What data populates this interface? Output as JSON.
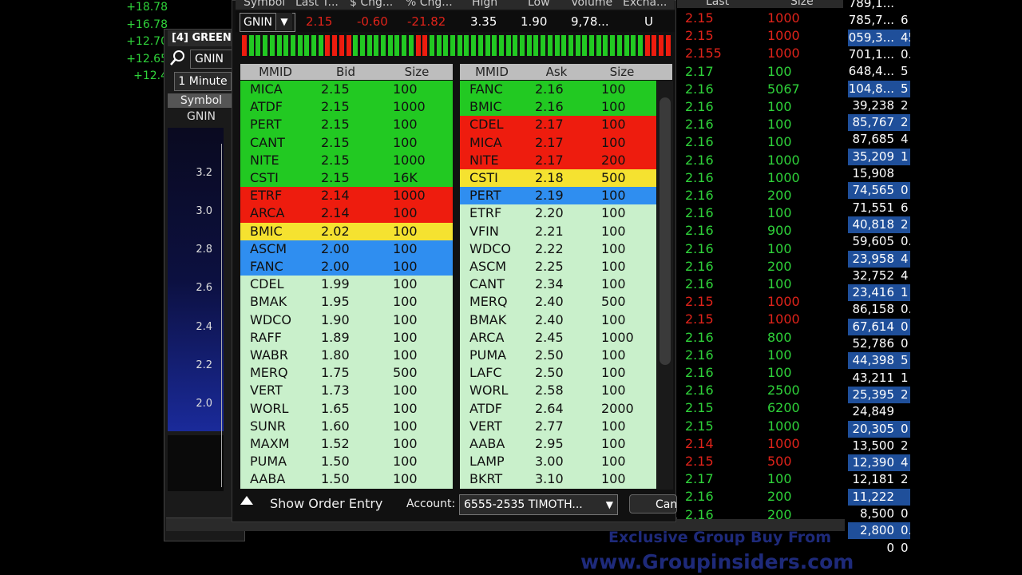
{
  "left_values": [
    "+18.78",
    "+16.78",
    "+12.70",
    "+12.65",
    "+12.4"
  ],
  "chart": {
    "title": "[4] GREEN",
    "symbol_input": "GNIN",
    "interval": "1 Minute",
    "symbol_header": "Symbol",
    "symbol_value": "GNIN",
    "ticks": [
      "3.2",
      "3.0",
      "2.8",
      "2.6",
      "2.4",
      "2.2",
      "2.0"
    ]
  },
  "quote_header": {
    "symbol": "Symbol",
    "last": "Last T...",
    "chg": "$ Chg...",
    "pct_chg": "% Chg...",
    "high": "High",
    "low": "Low",
    "volume": "Volume",
    "exchange": "Excha..."
  },
  "quote": {
    "symbol": "GNIN",
    "last": "2.15",
    "chg": "-0.60",
    "pct_chg": "-21.82",
    "high": "3.35",
    "low": "1.90",
    "volume": "9,78...",
    "exchange": "U"
  },
  "tick_bar": [
    "r",
    "g",
    "g",
    "g",
    "g",
    "g",
    "g",
    "g",
    "g",
    "g",
    "g",
    "g",
    "r",
    "r",
    "r",
    "r",
    "g",
    "g",
    "g",
    "g",
    "g",
    "g",
    "g",
    "g",
    "g",
    "r",
    "r",
    "g",
    "g",
    "g",
    "g",
    "g",
    "g",
    "g",
    "g",
    "g",
    "g",
    "g",
    "g",
    "g",
    "g",
    "g",
    "g",
    "g",
    "g",
    "g",
    "g",
    "g",
    "g",
    "g",
    "g",
    "g",
    "g",
    "g",
    "g",
    "g",
    "g",
    "g",
    "r",
    "r",
    "r",
    "r"
  ],
  "colors": {
    "green": "#22c922",
    "red": "#ee1c0e",
    "yellow": "#f5e230",
    "blue": "#2f8ef0",
    "light": "#c9f0cb",
    "ts_green": "#2fd23a",
    "ts_red": "#e0231a"
  },
  "bid_headers": {
    "mmid": "MMID",
    "price": "Bid",
    "size": "Size"
  },
  "ask_headers": {
    "mmid": "MMID",
    "price": "Ask",
    "size": "Size"
  },
  "bids": [
    {
      "mmid": "MICA",
      "price": "2.15",
      "size": "100",
      "level": "green"
    },
    {
      "mmid": "ATDF",
      "price": "2.15",
      "size": "1000",
      "level": "green"
    },
    {
      "mmid": "PERT",
      "price": "2.15",
      "size": "100",
      "level": "green"
    },
    {
      "mmid": "CANT",
      "price": "2.15",
      "size": "100",
      "level": "green"
    },
    {
      "mmid": "NITE",
      "price": "2.15",
      "size": "1000",
      "level": "green"
    },
    {
      "mmid": "CSTI",
      "price": "2.15",
      "size": "16K",
      "level": "green"
    },
    {
      "mmid": "ETRF",
      "price": "2.14",
      "size": "1000",
      "level": "red"
    },
    {
      "mmid": "ARCA",
      "price": "2.14",
      "size": "100",
      "level": "red"
    },
    {
      "mmid": "BMIC",
      "price": "2.02",
      "size": "100",
      "level": "yellow"
    },
    {
      "mmid": "ASCM",
      "price": "2.00",
      "size": "100",
      "level": "blue"
    },
    {
      "mmid": "FANC",
      "price": "2.00",
      "size": "100",
      "level": "blue"
    },
    {
      "mmid": "CDEL",
      "price": "1.99",
      "size": "100",
      "level": "light"
    },
    {
      "mmid": "BMAK",
      "price": "1.95",
      "size": "100",
      "level": "light"
    },
    {
      "mmid": "WDCO",
      "price": "1.90",
      "size": "100",
      "level": "light"
    },
    {
      "mmid": "RAFF",
      "price": "1.89",
      "size": "100",
      "level": "light"
    },
    {
      "mmid": "WABR",
      "price": "1.80",
      "size": "100",
      "level": "light"
    },
    {
      "mmid": "MERQ",
      "price": "1.75",
      "size": "500",
      "level": "light"
    },
    {
      "mmid": "VERT",
      "price": "1.73",
      "size": "100",
      "level": "light"
    },
    {
      "mmid": "WORL",
      "price": "1.65",
      "size": "100",
      "level": "light"
    },
    {
      "mmid": "SUNR",
      "price": "1.60",
      "size": "100",
      "level": "light"
    },
    {
      "mmid": "MAXM",
      "price": "1.52",
      "size": "100",
      "level": "light"
    },
    {
      "mmid": "PUMA",
      "price": "1.50",
      "size": "100",
      "level": "light"
    },
    {
      "mmid": "AABA",
      "price": "1.50",
      "size": "100",
      "level": "light"
    }
  ],
  "asks": [
    {
      "mmid": "FANC",
      "price": "2.16",
      "size": "100",
      "level": "green"
    },
    {
      "mmid": "BMIC",
      "price": "2.16",
      "size": "100",
      "level": "green"
    },
    {
      "mmid": "CDEL",
      "price": "2.17",
      "size": "100",
      "level": "red"
    },
    {
      "mmid": "MICA",
      "price": "2.17",
      "size": "100",
      "level": "red"
    },
    {
      "mmid": "NITE",
      "price": "2.17",
      "size": "200",
      "level": "red"
    },
    {
      "mmid": "CSTI",
      "price": "2.18",
      "size": "500",
      "level": "yellow"
    },
    {
      "mmid": "PERT",
      "price": "2.19",
      "size": "100",
      "level": "blue"
    },
    {
      "mmid": "ETRF",
      "price": "2.20",
      "size": "100",
      "level": "light"
    },
    {
      "mmid": "VFIN",
      "price": "2.21",
      "size": "100",
      "level": "light"
    },
    {
      "mmid": "WDCO",
      "price": "2.22",
      "size": "100",
      "level": "light"
    },
    {
      "mmid": "ASCM",
      "price": "2.25",
      "size": "100",
      "level": "light"
    },
    {
      "mmid": "CANT",
      "price": "2.34",
      "size": "100",
      "level": "light"
    },
    {
      "mmid": "MERQ",
      "price": "2.40",
      "size": "500",
      "level": "light"
    },
    {
      "mmid": "BMAK",
      "price": "2.40",
      "size": "100",
      "level": "light"
    },
    {
      "mmid": "ARCA",
      "price": "2.45",
      "size": "1000",
      "level": "light"
    },
    {
      "mmid": "PUMA",
      "price": "2.50",
      "size": "100",
      "level": "light"
    },
    {
      "mmid": "LAFC",
      "price": "2.50",
      "size": "100",
      "level": "light"
    },
    {
      "mmid": "WORL",
      "price": "2.58",
      "size": "100",
      "level": "light"
    },
    {
      "mmid": "ATDF",
      "price": "2.64",
      "size": "2000",
      "level": "light"
    },
    {
      "mmid": "VERT",
      "price": "2.77",
      "size": "100",
      "level": "light"
    },
    {
      "mmid": "AABA",
      "price": "2.95",
      "size": "100",
      "level": "light"
    },
    {
      "mmid": "LAMP",
      "price": "3.00",
      "size": "100",
      "level": "light"
    },
    {
      "mmid": "BKRT",
      "price": "3.10",
      "size": "100",
      "level": "light"
    }
  ],
  "order_bar": {
    "show_order_entry": "Show Order Entry",
    "account_label": "Account:",
    "account_value": "6555-2535 TIMOTH...",
    "cancel": "Can"
  },
  "time_sales": {
    "headers": {
      "last": "Last",
      "size": "Size"
    },
    "rows": [
      {
        "price": "2.15",
        "size": "1000",
        "side": "red"
      },
      {
        "price": "2.15",
        "size": "1000",
        "side": "red"
      },
      {
        "price": "2.155",
        "size": "1000",
        "side": "red"
      },
      {
        "price": "2.17",
        "size": "100",
        "side": "green"
      },
      {
        "price": "2.16",
        "size": "5067",
        "side": "green"
      },
      {
        "price": "2.16",
        "size": "100",
        "side": "green"
      },
      {
        "price": "2.16",
        "size": "100",
        "side": "green"
      },
      {
        "price": "2.16",
        "size": "100",
        "side": "green"
      },
      {
        "price": "2.16",
        "size": "1000",
        "side": "green"
      },
      {
        "price": "2.16",
        "size": "1000",
        "side": "green"
      },
      {
        "price": "2.16",
        "size": "200",
        "side": "green"
      },
      {
        "price": "2.16",
        "size": "100",
        "side": "green"
      },
      {
        "price": "2.16",
        "size": "900",
        "side": "green"
      },
      {
        "price": "2.16",
        "size": "100",
        "side": "green"
      },
      {
        "price": "2.16",
        "size": "200",
        "side": "green"
      },
      {
        "price": "2.16",
        "size": "100",
        "side": "green"
      },
      {
        "price": "2.15",
        "size": "1000",
        "side": "red"
      },
      {
        "price": "2.15",
        "size": "1000",
        "side": "red"
      },
      {
        "price": "2.16",
        "size": "800",
        "side": "green"
      },
      {
        "price": "2.16",
        "size": "100",
        "side": "green"
      },
      {
        "price": "2.16",
        "size": "100",
        "side": "green"
      },
      {
        "price": "2.16",
        "size": "2500",
        "side": "green"
      },
      {
        "price": "2.15",
        "size": "6200",
        "side": "green"
      },
      {
        "price": "2.15",
        "size": "1000",
        "side": "green"
      },
      {
        "price": "2.14",
        "size": "1000",
        "side": "red"
      },
      {
        "price": "2.15",
        "size": "500",
        "side": "red"
      },
      {
        "price": "2.17",
        "size": "100",
        "side": "green"
      },
      {
        "price": "2.16",
        "size": "200",
        "side": "green"
      },
      {
        "price": "2.16",
        "size": "200",
        "side": "green"
      }
    ]
  },
  "right_list": [
    {
      "v": "789,1...",
      "e": "",
      "hl": false
    },
    {
      "v": "785,7...",
      "e": "6",
      "hl": false
    },
    {
      "v": "059,3...",
      "e": "45",
      "hl": true
    },
    {
      "v": "701,1...",
      "e": "0.",
      "hl": false
    },
    {
      "v": "648,4...",
      "e": "5",
      "hl": false
    },
    {
      "v": "104,8...",
      "e": "5",
      "hl": true
    },
    {
      "v": "39,238",
      "e": "2",
      "hl": false
    },
    {
      "v": "85,767",
      "e": "2",
      "hl": true
    },
    {
      "v": "87,685",
      "e": "4",
      "hl": false
    },
    {
      "v": "35,209",
      "e": "1",
      "hl": true
    },
    {
      "v": "15,908",
      "e": "",
      "hl": false
    },
    {
      "v": "74,565",
      "e": "0",
      "hl": true
    },
    {
      "v": "71,551",
      "e": "6",
      "hl": false
    },
    {
      "v": "40,818",
      "e": "2",
      "hl": true
    },
    {
      "v": "59,605",
      "e": "0.",
      "hl": false
    },
    {
      "v": "23,958",
      "e": "4",
      "hl": true
    },
    {
      "v": "32,752",
      "e": "4",
      "hl": false
    },
    {
      "v": "23,416",
      "e": "1",
      "hl": true
    },
    {
      "v": "86,158",
      "e": "0.",
      "hl": false
    },
    {
      "v": "67,614",
      "e": "0",
      "hl": true
    },
    {
      "v": "52,786",
      "e": "0",
      "hl": false
    },
    {
      "v": "44,398",
      "e": "5",
      "hl": true
    },
    {
      "v": "43,211",
      "e": "1",
      "hl": false
    },
    {
      "v": "25,395",
      "e": "2",
      "hl": true
    },
    {
      "v": "24,849",
      "e": "",
      "hl": false
    },
    {
      "v": "20,305",
      "e": "0",
      "hl": true
    },
    {
      "v": "13,500",
      "e": "2",
      "hl": false
    },
    {
      "v": "12,390",
      "e": "4",
      "hl": true
    },
    {
      "v": "12,181",
      "e": "2",
      "hl": false
    },
    {
      "v": "11,222",
      "e": "",
      "hl": true
    },
    {
      "v": "8,500",
      "e": "0",
      "hl": false
    },
    {
      "v": "2,800",
      "e": "0.",
      "hl": true
    },
    {
      "v": "0",
      "e": "0",
      "hl": false
    }
  ],
  "watermark": {
    "line1": "Exclusive Group Buy From",
    "line2": "www.Groupinsiders.com"
  }
}
